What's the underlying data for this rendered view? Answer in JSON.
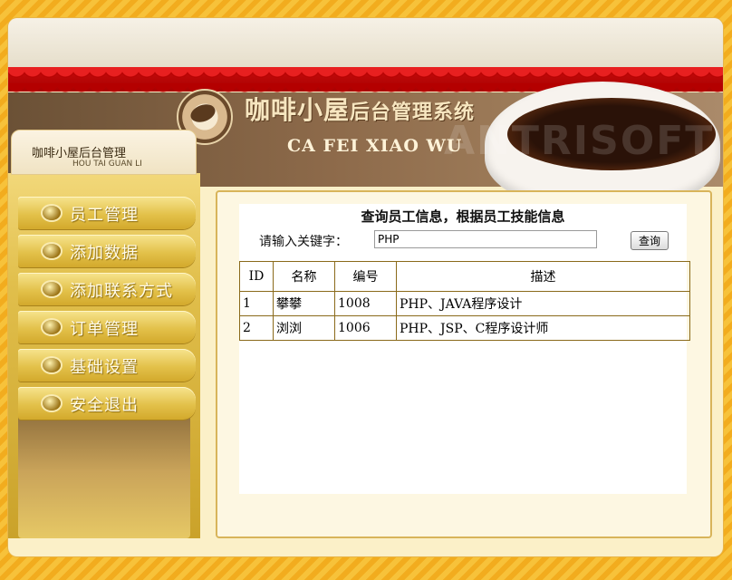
{
  "header": {
    "brand_cn": "咖啡小屋",
    "brand_cn_suffix": "后台管理系统",
    "brand_en": "CA FEI XIAO WU"
  },
  "sidebar": {
    "title": "咖啡小屋后台管理",
    "subtitle": "HOU TAI GUAN LI",
    "items": [
      {
        "label": "员工管理"
      },
      {
        "label": "添加数据"
      },
      {
        "label": "添加联系方式"
      },
      {
        "label": "订单管理"
      },
      {
        "label": "基础设置"
      },
      {
        "label": "安全退出"
      }
    ]
  },
  "main": {
    "title": "查询员工信息，根据员工技能信息",
    "search_label": "请输入关键字：",
    "search_value": "PHP",
    "search_button": "查询",
    "table": {
      "headers": [
        "ID",
        "名称",
        "编号",
        "描述"
      ],
      "rows": [
        [
          "1",
          "攀攀",
          "1008",
          "PHP、JAVA程序设计"
        ],
        [
          "2",
          "浏浏",
          "1006",
          "PHP、JSP、C程序设计师"
        ]
      ]
    }
  }
}
